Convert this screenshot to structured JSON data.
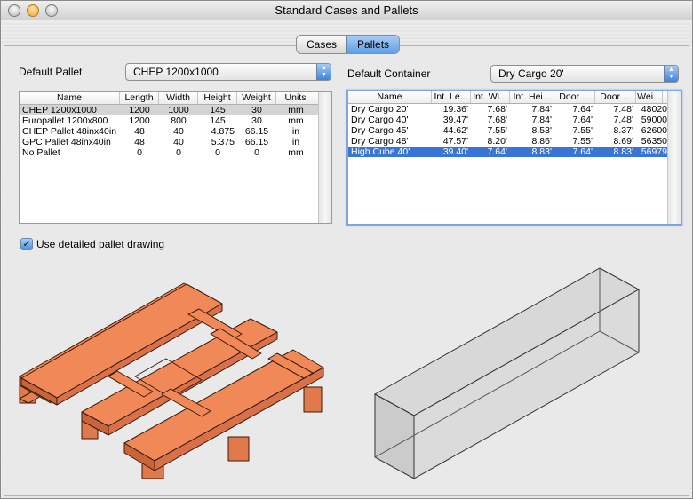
{
  "window": {
    "title": "Standard Cases and Pallets"
  },
  "tabs": [
    {
      "label": "Cases",
      "selected": false
    },
    {
      "label": "Pallets",
      "selected": true
    }
  ],
  "pallet": {
    "label": "Default Pallet",
    "selected": "CHEP 1200x1000",
    "columns": [
      "Name",
      "Length",
      "Width",
      "Height",
      "Weight",
      "Units"
    ],
    "rows": [
      [
        "CHEP 1200x1000",
        "1200",
        "1000",
        "145",
        "30",
        "mm"
      ],
      [
        "Europallet 1200x800",
        "1200",
        "800",
        "145",
        "30",
        "mm"
      ],
      [
        "CHEP Pallet 48inx40in",
        "48",
        "40",
        "4.875",
        "66.15",
        "in"
      ],
      [
        "GPC Pallet 48inx40in",
        "48",
        "40",
        "5.375",
        "66.15",
        "in"
      ],
      [
        "No Pallet",
        "0",
        "0",
        "0",
        "0",
        "mm"
      ]
    ],
    "selected_row": 0
  },
  "container": {
    "label": "Default Container",
    "selected": "Dry Cargo 20'",
    "columns": [
      "Name",
      "Int. Le...",
      "Int. Wi...",
      "Int. Hei...",
      "Door ...",
      "Door ...",
      "Wei..."
    ],
    "rows": [
      [
        "Dry Cargo 20'",
        "19.36'",
        "7.68'",
        "7.84'",
        "7.64'",
        "7.48'",
        "48020"
      ],
      [
        "Dry Cargo 40'",
        "39.47'",
        "7.68'",
        "7.84'",
        "7.64'",
        "7.48'",
        "59000"
      ],
      [
        "Dry Cargo 45'",
        "44.62'",
        "7.55'",
        "8.53'",
        "7.55'",
        "8.37'",
        "62600"
      ],
      [
        "Dry Cargo 48'",
        "47.57'",
        "8.20'",
        "8.86'",
        "7.55'",
        "8.69'",
        "56350"
      ],
      [
        "High Cube 40'",
        "39.40'",
        "7.64'",
        "8.83'",
        "7.64'",
        "8.83'",
        "56979"
      ]
    ],
    "selected_row": 4
  },
  "options": {
    "detailed_drawing_label": "Use detailed pallet drawing",
    "detailed_drawing_checked": true
  },
  "colors": {
    "pallet_wood": "#f08858",
    "selection_blue": "#3875d7",
    "container_fill": "#d6d6d6"
  },
  "icons": {
    "checkmark": "✓",
    "popup_arrows": "▲▼"
  }
}
